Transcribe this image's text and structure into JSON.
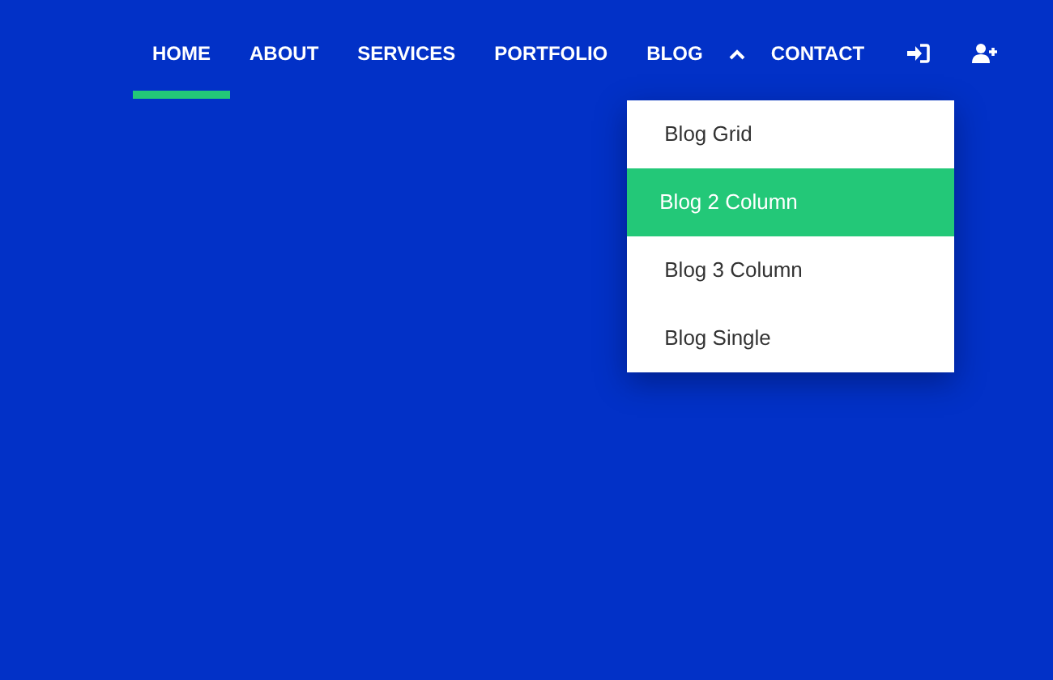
{
  "nav": {
    "items": [
      {
        "label": "HOME",
        "selected": true
      },
      {
        "label": "ABOUT",
        "selected": false
      },
      {
        "label": "SERVICES",
        "selected": false
      },
      {
        "label": "PORTFOLIO",
        "selected": false
      },
      {
        "label": "BLOG",
        "selected": false,
        "expanded": true,
        "children": [
          {
            "label": "Blog Grid",
            "selected": false
          },
          {
            "label": "Blog 2 Column",
            "selected": true
          },
          {
            "label": "Blog 3 Column",
            "selected": false
          },
          {
            "label": "Blog Single",
            "selected": false
          }
        ]
      },
      {
        "label": "CONTACT",
        "selected": false
      }
    ]
  }
}
